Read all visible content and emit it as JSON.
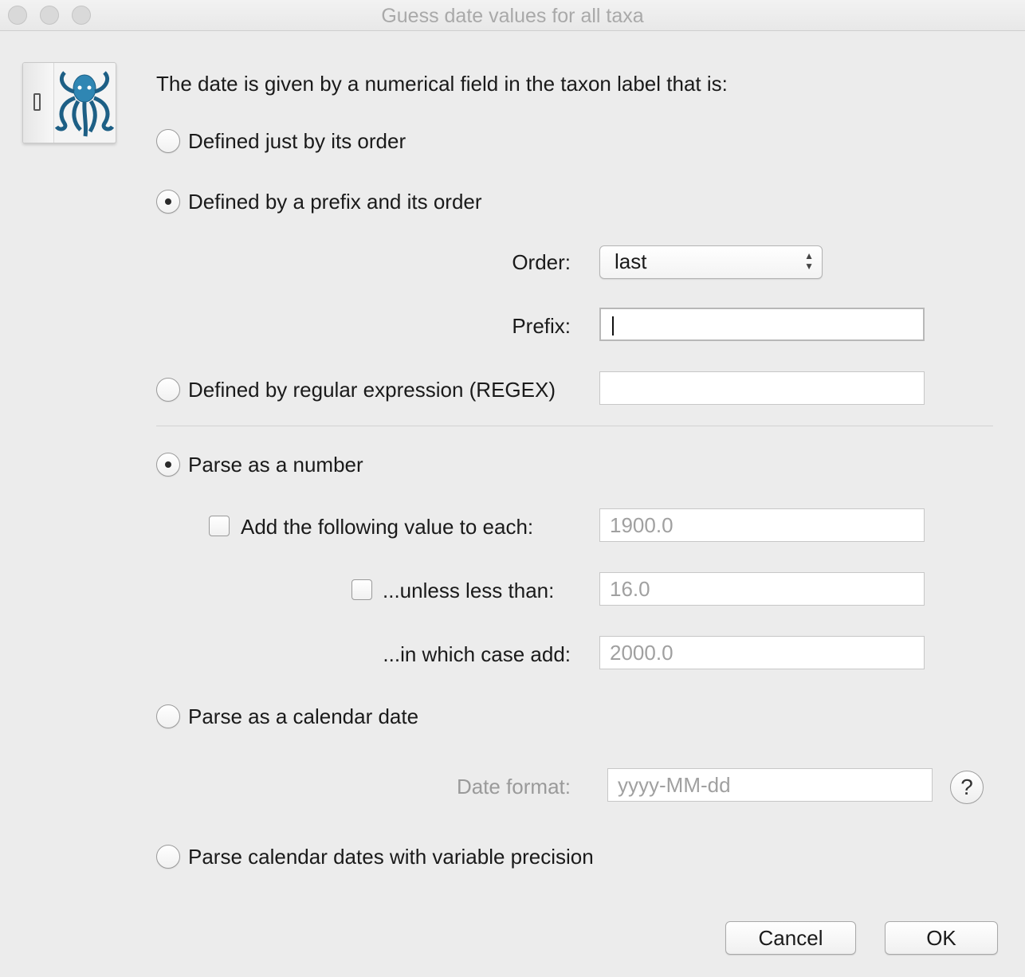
{
  "window": {
    "title": "Guess date values for all taxa",
    "icon": "octopus-app-icon"
  },
  "intro": "The date is given by a numerical field in the taxon label that is:",
  "field_definition": {
    "options": [
      {
        "label": "Defined just by its order",
        "selected": false
      },
      {
        "label": "Defined by a prefix and its order",
        "selected": true
      },
      {
        "label": "Defined by regular expression (REGEX)",
        "selected": false
      }
    ],
    "order_label": "Order:",
    "order_value": "last",
    "prefix_label": "Prefix:",
    "prefix_value": "",
    "regex_value": ""
  },
  "parse": {
    "number_label": "Parse as a number",
    "number_selected": true,
    "add_label": "Add the following value to each:",
    "add_checked": false,
    "add_value": "1900.0",
    "unless_label": "...unless less than:",
    "unless_checked": false,
    "unless_value": "16.0",
    "case_label": "...in which case add:",
    "case_value": "2000.0",
    "calendar_label": "Parse as a calendar date",
    "calendar_selected": false,
    "date_format_label": "Date format:",
    "date_format_value": "yyyy-MM-dd",
    "help_label": "?",
    "variable_label": "Parse calendar dates with variable precision",
    "variable_selected": false
  },
  "buttons": {
    "cancel": "Cancel",
    "ok": "OK"
  }
}
